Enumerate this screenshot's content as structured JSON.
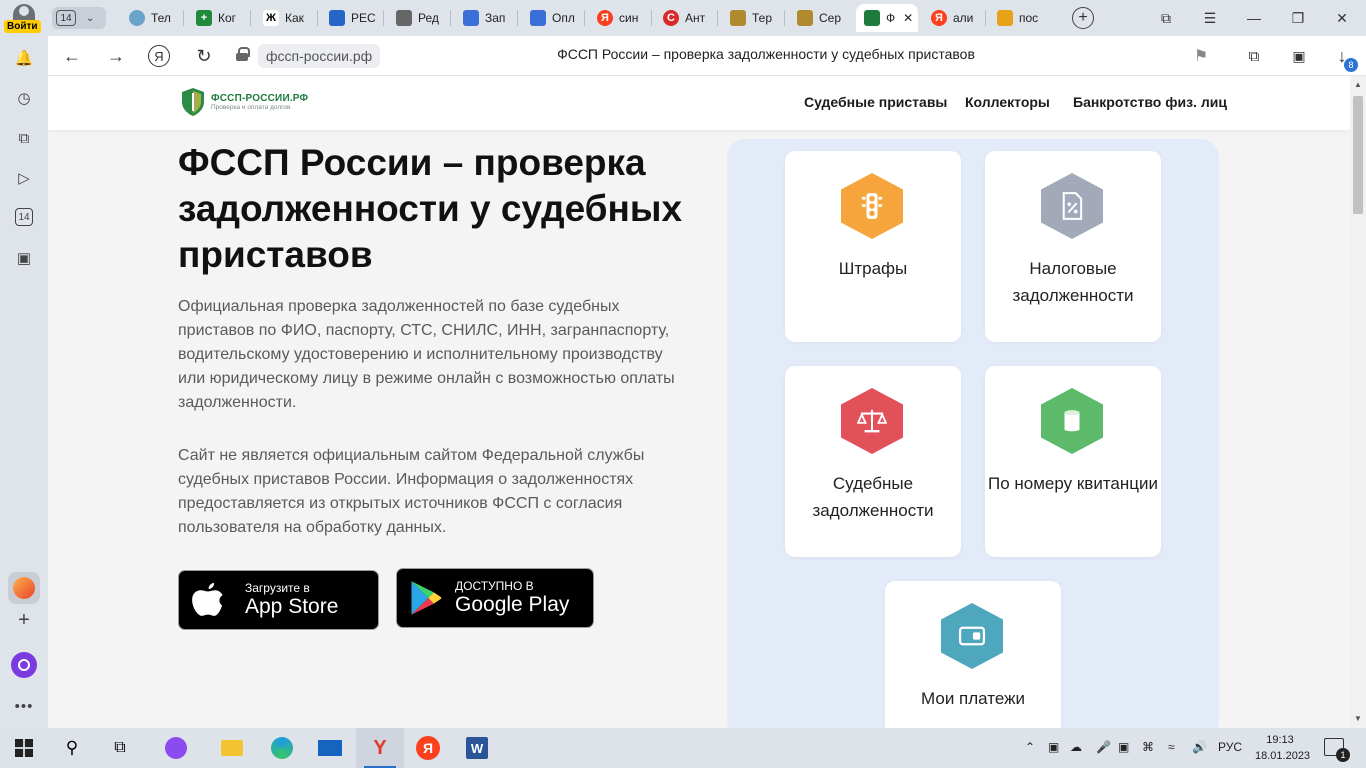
{
  "browser": {
    "profile_label": "Войти",
    "tab_count": "14",
    "tabs": [
      {
        "label": "Тел",
        "icon": "globe-icon",
        "color": "#6aa3c9"
      },
      {
        "label": "Ког",
        "icon": "plus-green-icon",
        "color": "#1e8a3c"
      },
      {
        "label": "Как",
        "icon": "zh-icon",
        "color": "#000000"
      },
      {
        "label": "РЕС",
        "icon": "bird-icon",
        "color": "#2565c8"
      },
      {
        "label": "Ред",
        "icon": "doc-icon",
        "color": "#666666"
      },
      {
        "label": "Зап",
        "icon": "russian-post-icon",
        "color": "#3b6fd8"
      },
      {
        "label": "Опл",
        "icon": "russian-post-icon",
        "color": "#3b6fd8"
      },
      {
        "label": "син",
        "icon": "yandex-icon",
        "color": "#fc3f1d"
      },
      {
        "label": "Ант",
        "icon": "antiplagiat-icon",
        "color": "#d92b2b"
      },
      {
        "label": "Тер",
        "icon": "emblem-icon",
        "color": "#b08a2e"
      },
      {
        "label": "Сер",
        "icon": "emblem-icon",
        "color": "#b08a2e"
      },
      {
        "label": "Ф",
        "icon": "fssp-shield-icon",
        "color": "#1f7a3e"
      },
      {
        "label": "али",
        "icon": "yandex-icon",
        "color": "#fc3f1d"
      },
      {
        "label": "пос",
        "icon": "landscape-icon",
        "color": "#e8a21a"
      }
    ],
    "url": "фссп-россии.рф",
    "page_title": "ФССП России – проверка задолженности у судебных приставов",
    "downloads_badge": "8"
  },
  "site": {
    "logo_title": "ФССП-РОССИИ.РФ",
    "logo_subtitle": "Проверка и оплата долгов",
    "nav": [
      "Судебные приставы",
      "Коллекторы",
      "Банкротство физ. лиц"
    ],
    "heading": "ФССП России – проверка задолженности у судебных приставов",
    "intro": "Официальная проверка задолженностей по базе судебных приставов по ФИО, паспорту, СТС, СНИЛС, ИНН, загранпаспорту, водительскому удостоверению и исполнительному производству или юридическому лицу в режиме онлайн с возможностью оплаты задолженности.",
    "disclaimer": "Сайт не является официальным сайтом Федеральной службы судебных приставов России. Информация о задолженностях предоставляется из открытых источников ФССП с согласия пользователя на обработку данных.",
    "appstore_small": "Загрузите в",
    "appstore_big": "App Store",
    "gplay_small": "ДОСТУПНО В",
    "gplay_big": "Google Play",
    "cards": [
      {
        "label": "Штрафы",
        "icon": "traffic-light-icon",
        "color": "#f5a53b"
      },
      {
        "label": "Налоговые задолженности",
        "icon": "tax-doc-icon",
        "color": "#a3a9b8"
      },
      {
        "label": "Судебные задолженности",
        "icon": "scales-icon",
        "color": "#e2505a"
      },
      {
        "label": "По номеру квитанции",
        "icon": "receipt-icon",
        "color": "#5cba6a"
      },
      {
        "label": "Мои платежи",
        "icon": "wallet-icon",
        "color": "#4fa7bd"
      }
    ]
  },
  "taskbar": {
    "lang": "РУС",
    "time": "19:13",
    "date": "18.01.2023",
    "notif_count": "1"
  }
}
